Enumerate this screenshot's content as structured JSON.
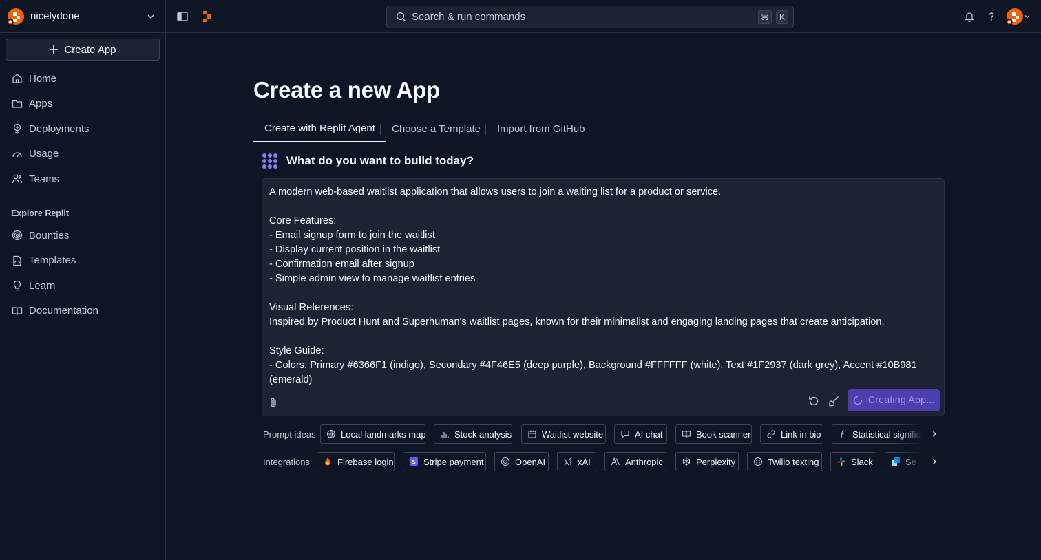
{
  "workspace": {
    "name": "nicelydone"
  },
  "sidebar": {
    "create_label": "Create App",
    "items": [
      {
        "label": "Home",
        "icon": "home-icon"
      },
      {
        "label": "Apps",
        "icon": "folder-icon"
      },
      {
        "label": "Deployments",
        "icon": "deployments-icon"
      },
      {
        "label": "Usage",
        "icon": "gauge-icon"
      },
      {
        "label": "Teams",
        "icon": "users-icon"
      }
    ],
    "explore_label": "Explore Replit",
    "explore_items": [
      {
        "label": "Bounties",
        "icon": "target-icon"
      },
      {
        "label": "Templates",
        "icon": "template-icon"
      },
      {
        "label": "Learn",
        "icon": "lightbulb-icon"
      },
      {
        "label": "Documentation",
        "icon": "book-icon"
      }
    ]
  },
  "topbar": {
    "search_placeholder": "Search & run commands",
    "kbd_cmd": "⌘",
    "kbd_k": "K"
  },
  "main": {
    "title": "Create a new App",
    "tabs": [
      {
        "label": "Create with Replit Agent",
        "active": true
      },
      {
        "label": "Choose a Template",
        "active": false
      },
      {
        "label": "Import from GitHub",
        "active": false
      }
    ],
    "question": "What do you want to build today?",
    "prompt_text": "A modern web-based waitlist application that allows users to join a waiting list for a product or service.\n\nCore Features:\n- Email signup form to join the waitlist\n- Display current position in the waitlist\n- Confirmation email after signup\n- Simple admin view to manage waitlist entries\n\nVisual References:\nInspired by Product Hunt and Superhuman's waitlist pages, known for their minimalist and engaging landing pages that create anticipation.\n\nStyle Guide:\n- Colors: Primary #6366F1 (indigo), Secondary #4F46E5 (deep purple), Background #FFFFFF (white), Text #1F2937 (dark grey), Accent #10B981\n(emerald)",
    "creating_label": "Creating App..."
  },
  "prompt_ideas": {
    "label": "Prompt ideas",
    "items": [
      "Local landmarks map",
      "Stock analysis",
      "Waitlist website",
      "AI chat",
      "Book scanner",
      "Link in bio",
      "Statistical signific"
    ]
  },
  "integrations": {
    "label": "Integrations",
    "items": [
      "Firebase login",
      "Stripe payment",
      "OpenAI",
      "xAI",
      "Anthropic",
      "Perplexity",
      "Twilio texting",
      "Slack",
      "Se"
    ]
  },
  "colors": {
    "background": "#0e1525",
    "surface": "#1c2333",
    "border": "#2b3245",
    "accent": "#f26207",
    "button": "#4b3fb0",
    "agent_purple": "#8b7cf6"
  }
}
